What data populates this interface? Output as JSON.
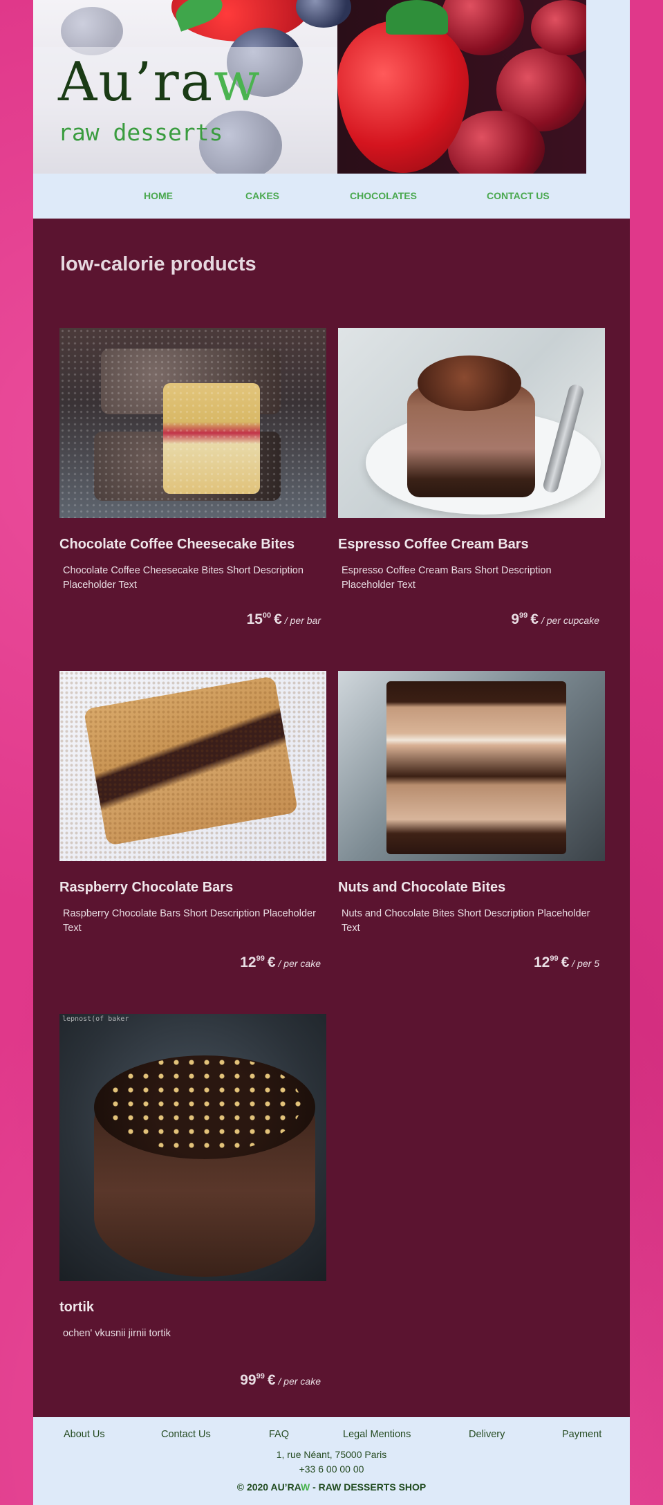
{
  "header": {
    "logo_main": "Au’ra",
    "logo_accent": "w",
    "tagline": "raw desserts"
  },
  "nav": [
    {
      "label": "HOME"
    },
    {
      "label": "CAKES"
    },
    {
      "label": "CHOCOLATES"
    },
    {
      "label": "CONTACT US"
    }
  ],
  "main": {
    "section_title": "low-calorie products",
    "products": [
      {
        "title": "Chocolate Coffee Cheesecake Bites",
        "description": "Chocolate Coffee Cheesecake Bites Short Description Placeholder Text",
        "price_int": "15",
        "price_dec": "00",
        "currency": "€",
        "unit": "/ per bar"
      },
      {
        "title": "Espresso Coffee Cream Bars",
        "description": "Espresso Coffee Cream Bars Short Description Placeholder Text",
        "price_int": "9",
        "price_dec": "99",
        "currency": "€",
        "unit": "/ per cupcake"
      },
      {
        "title": "Raspberry Chocolate Bars",
        "description": "Raspberry Chocolate Bars Short Description Placeholder Text",
        "price_int": "12",
        "price_dec": "99",
        "currency": "€",
        "unit": "/ per cake"
      },
      {
        "title": "Nuts and Chocolate Bites",
        "description": "Nuts and Chocolate Bites Short Description Placeholder Text",
        "price_int": "12",
        "price_dec": "99",
        "currency": "€",
        "unit": "/ per 5"
      },
      {
        "title": "tortik",
        "description": "ochen' vkusnii jirnii tortik",
        "price_int": "99",
        "price_dec": "99",
        "currency": "€",
        "unit": "/ per cake",
        "image_watermark": "lepnost(of baker"
      }
    ]
  },
  "footer": {
    "links": [
      {
        "label": "About Us"
      },
      {
        "label": "Contact Us"
      },
      {
        "label": "FAQ"
      },
      {
        "label": "Legal Mentions"
      },
      {
        "label": "Delivery"
      },
      {
        "label": "Payment"
      }
    ],
    "address": "1, rue Néant, 75000 Paris",
    "phone": "+33 6 00 00 00",
    "copyright_prefix": "© 2020 AU’RA",
    "copyright_accent": "W",
    "copyright_suffix": " - RAW DESSERTS SHOP"
  },
  "colors": {
    "background_pink": "#e0388a",
    "main_bg": "#5b1430",
    "header_bg": "#deeaf9",
    "nav_green": "#4aa84f",
    "logo_dark_green": "#1a3b15"
  }
}
